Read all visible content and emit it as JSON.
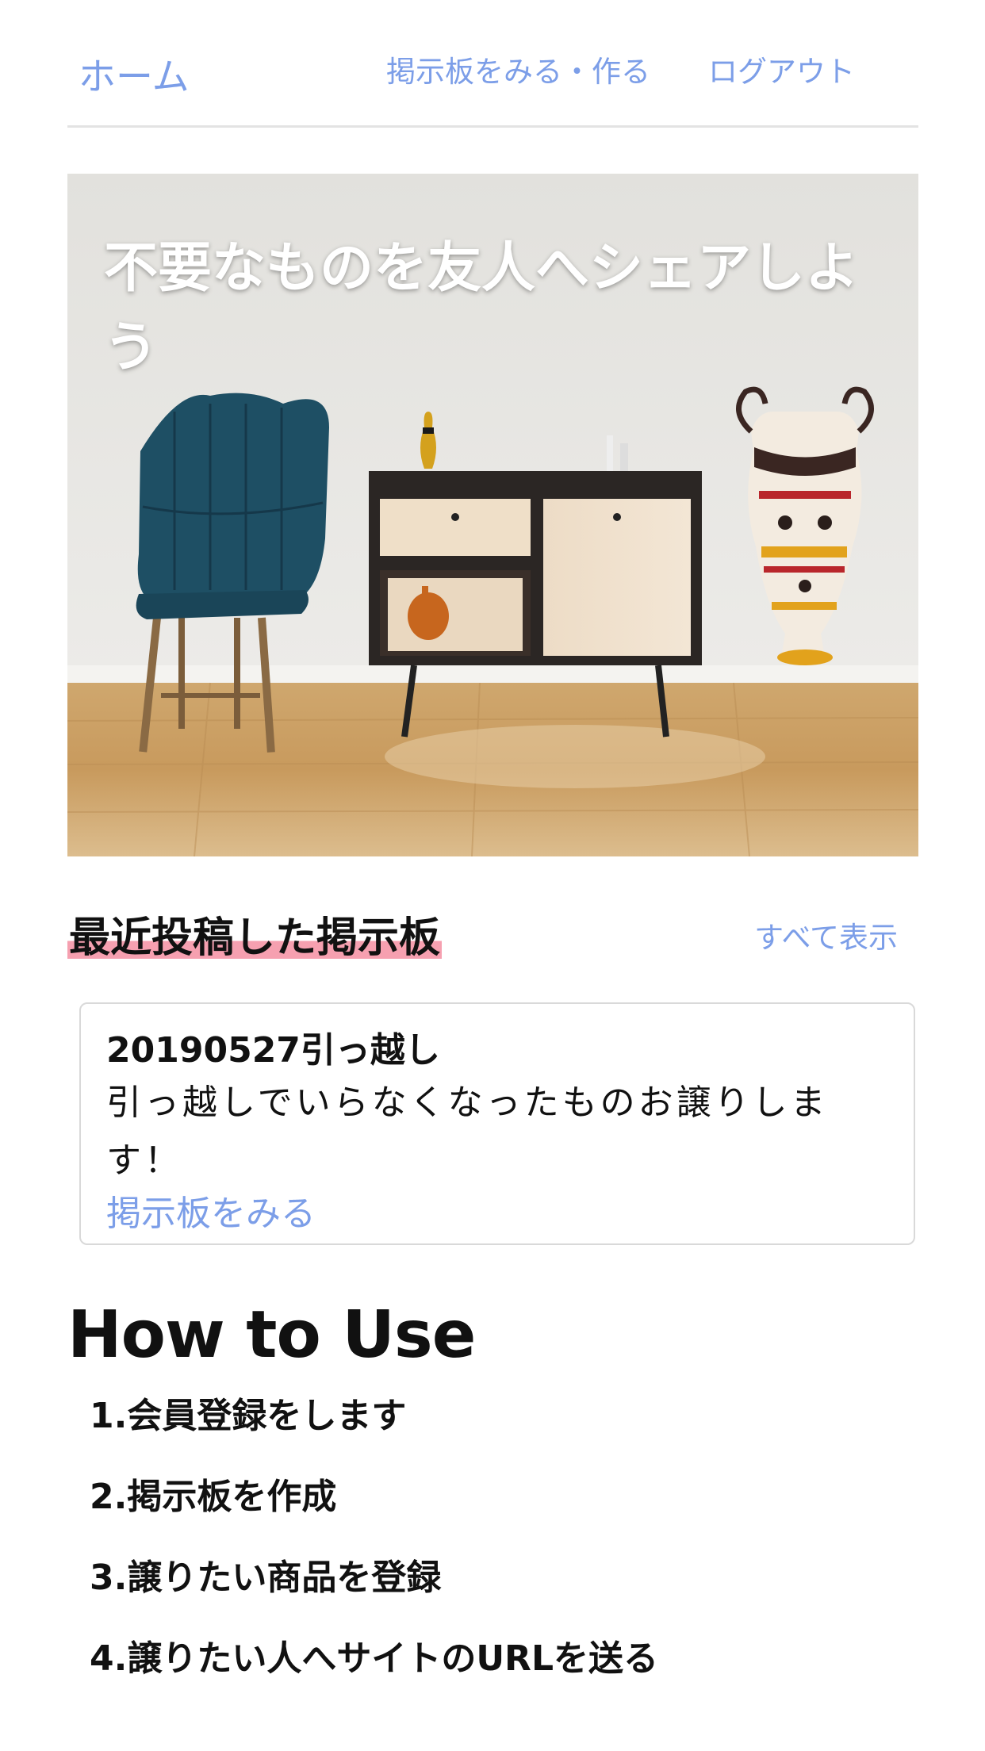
{
  "nav": {
    "home": "ホーム",
    "boards": "掲示板をみる・作る",
    "logout": "ログアウト"
  },
  "hero": {
    "title": "不要なものを友人へシェアしよう"
  },
  "recent": {
    "title": "最近投稿した掲示板",
    "show_all": "すべて表示",
    "cards": [
      {
        "title": "20190527引っ越し",
        "description": "引っ越しでいらなくなったものお譲りします！",
        "link": "掲示板をみる"
      }
    ]
  },
  "howto": {
    "title": "How to Use",
    "steps": [
      "1.会員登録をします",
      "2.掲示板を作成",
      "3.譲りたい商品を登録",
      "4.譲りたい人へサイトのURLを送る"
    ]
  },
  "colors": {
    "link": "#7c9ee8",
    "highlight": "#f6a0b0"
  }
}
